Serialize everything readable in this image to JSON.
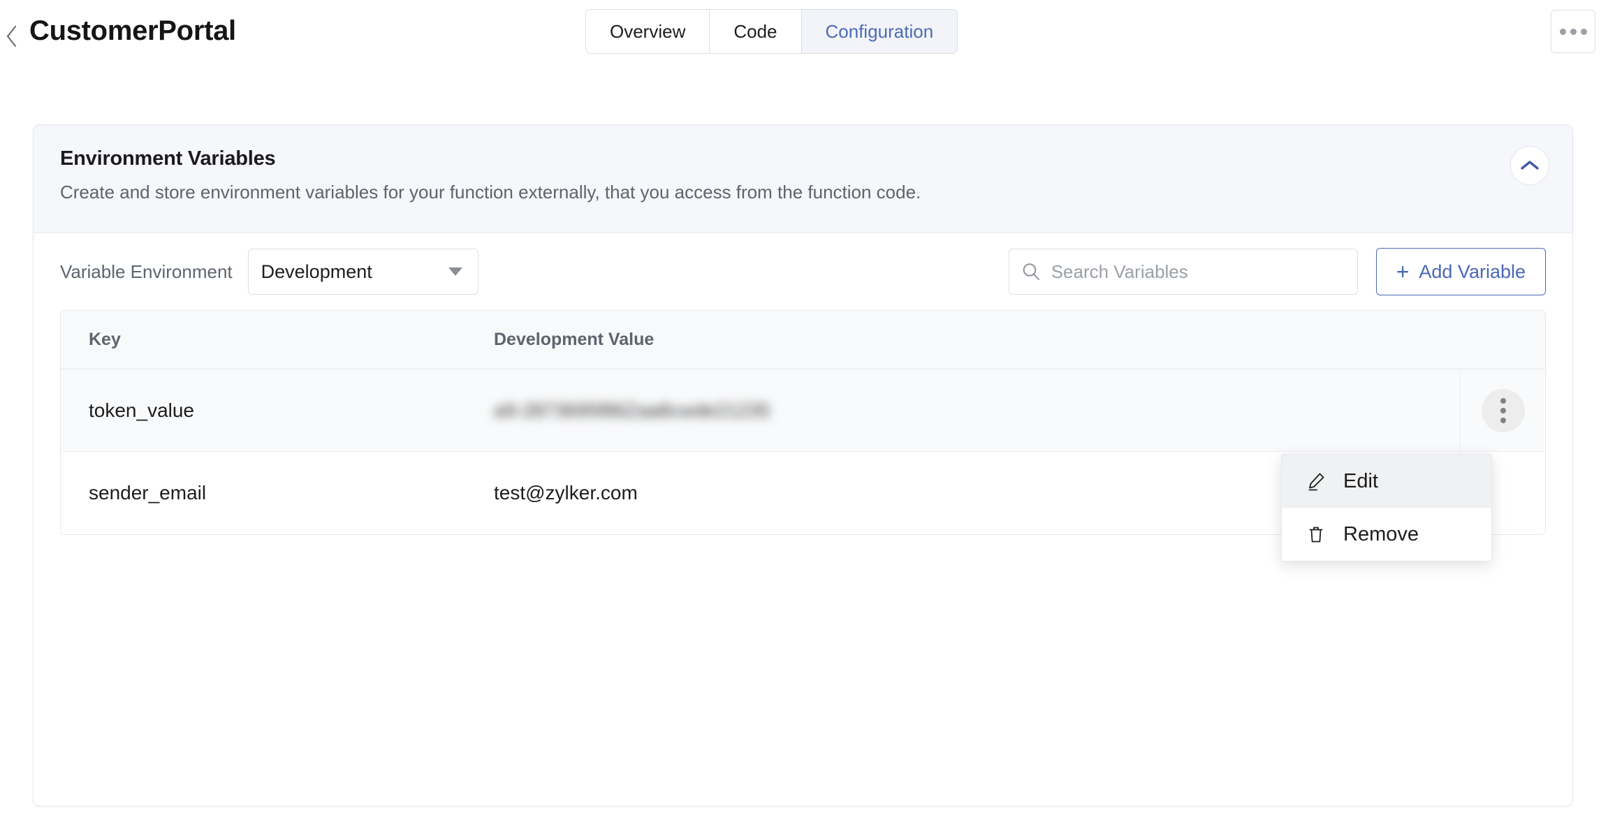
{
  "header": {
    "back_icon": "chevron-left-icon",
    "title": "CustomerPortal",
    "tabs": [
      {
        "label": "Overview",
        "active": false
      },
      {
        "label": "Code",
        "active": false
      },
      {
        "label": "Configuration",
        "active": true
      }
    ],
    "more_icon": "ellipsis-horizontal-icon"
  },
  "section": {
    "title": "Environment Variables",
    "subtitle": "Create and store environment variables for your function externally, that you access from the function code.",
    "collapse_icon": "chevron-up-icon"
  },
  "controls": {
    "env_label": "Variable Environment",
    "env_value": "Development",
    "env_options": [
      "Development"
    ],
    "env_caret_icon": "caret-down-icon",
    "search_icon": "search-icon",
    "search_placeholder": "Search Variables",
    "search_value": "",
    "add_button": {
      "plus": "+",
      "label": "Add Variable",
      "icon": "plus-icon"
    }
  },
  "table": {
    "columns": [
      "Key",
      "Development Value"
    ],
    "rows": [
      {
        "key": "token_value",
        "value": "a9-2873695f86Zaa8cwde21235",
        "redacted": true,
        "hovered": true,
        "menu_icon": "kebab-menu-icon"
      },
      {
        "key": "sender_email",
        "value": "test@zylker.com",
        "redacted": false,
        "hovered": false,
        "menu_icon": "kebab-menu-icon"
      }
    ]
  },
  "context_menu": {
    "items": [
      {
        "label": "Edit",
        "icon": "pencil-icon",
        "highlighted": true
      },
      {
        "label": "Remove",
        "icon": "trash-icon",
        "highlighted": false
      }
    ]
  },
  "colors": {
    "accent_blue": "#4d6ab5",
    "card_header_bg": "#f5f7fa",
    "table_header_bg": "#f7f9fb",
    "border": "#e4e8ed",
    "muted_text": "#5d646d"
  }
}
